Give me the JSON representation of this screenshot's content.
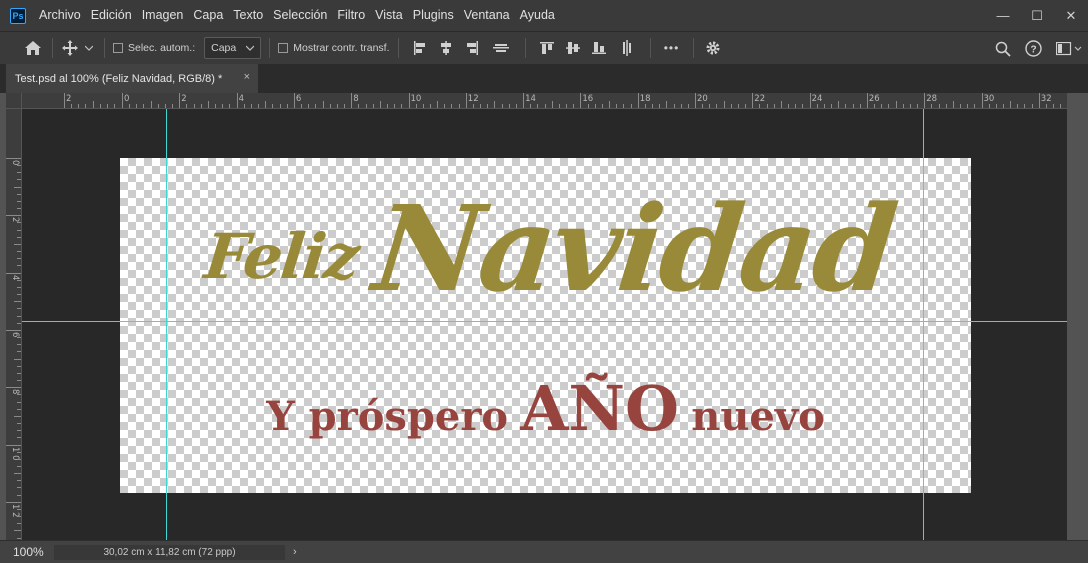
{
  "app": {
    "logo": "Ps",
    "accent": "#31a8ff"
  },
  "menu": [
    "Archivo",
    "Edición",
    "Imagen",
    "Capa",
    "Texto",
    "Selección",
    "Filtro",
    "Vista",
    "Plugins",
    "Ventana",
    "Ayuda"
  ],
  "window_controls": {
    "minimize": "—",
    "maximize": "☐",
    "close": "✕"
  },
  "options": {
    "auto_select_label": "Selec. autom.:",
    "auto_select_checked": false,
    "auto_select_value": "Capa",
    "transform_label": "Mostrar contr. transf.",
    "transform_checked": false,
    "more_label": "•••"
  },
  "document_tab": {
    "title": "Test.psd al 100% (Feliz  Navidad, RGB/8) *",
    "close": "×"
  },
  "ruler_top_labels": [
    "2",
    "0",
    "2",
    "4",
    "6",
    "8",
    "10",
    "12",
    "14",
    "16",
    "18",
    "20",
    "22",
    "24",
    "26",
    "28",
    "30",
    "32"
  ],
  "ruler_left_labels": [
    "0",
    "2",
    "4",
    "6",
    "8",
    "1 0",
    "1 2"
  ],
  "artwork": {
    "line1_small": "Feliz",
    "line1_big": "Navidad",
    "line2_a": "Y próspero",
    "line2_b": "AÑO",
    "line2_c": "nuevo",
    "gold": "#988a38",
    "red": "#97443f"
  },
  "guide_color": "#3fd6d6",
  "status": {
    "zoom": "100%",
    "doc_info": "30,02 cm x 11,82 cm (72 ppp)",
    "arrow": "›"
  }
}
